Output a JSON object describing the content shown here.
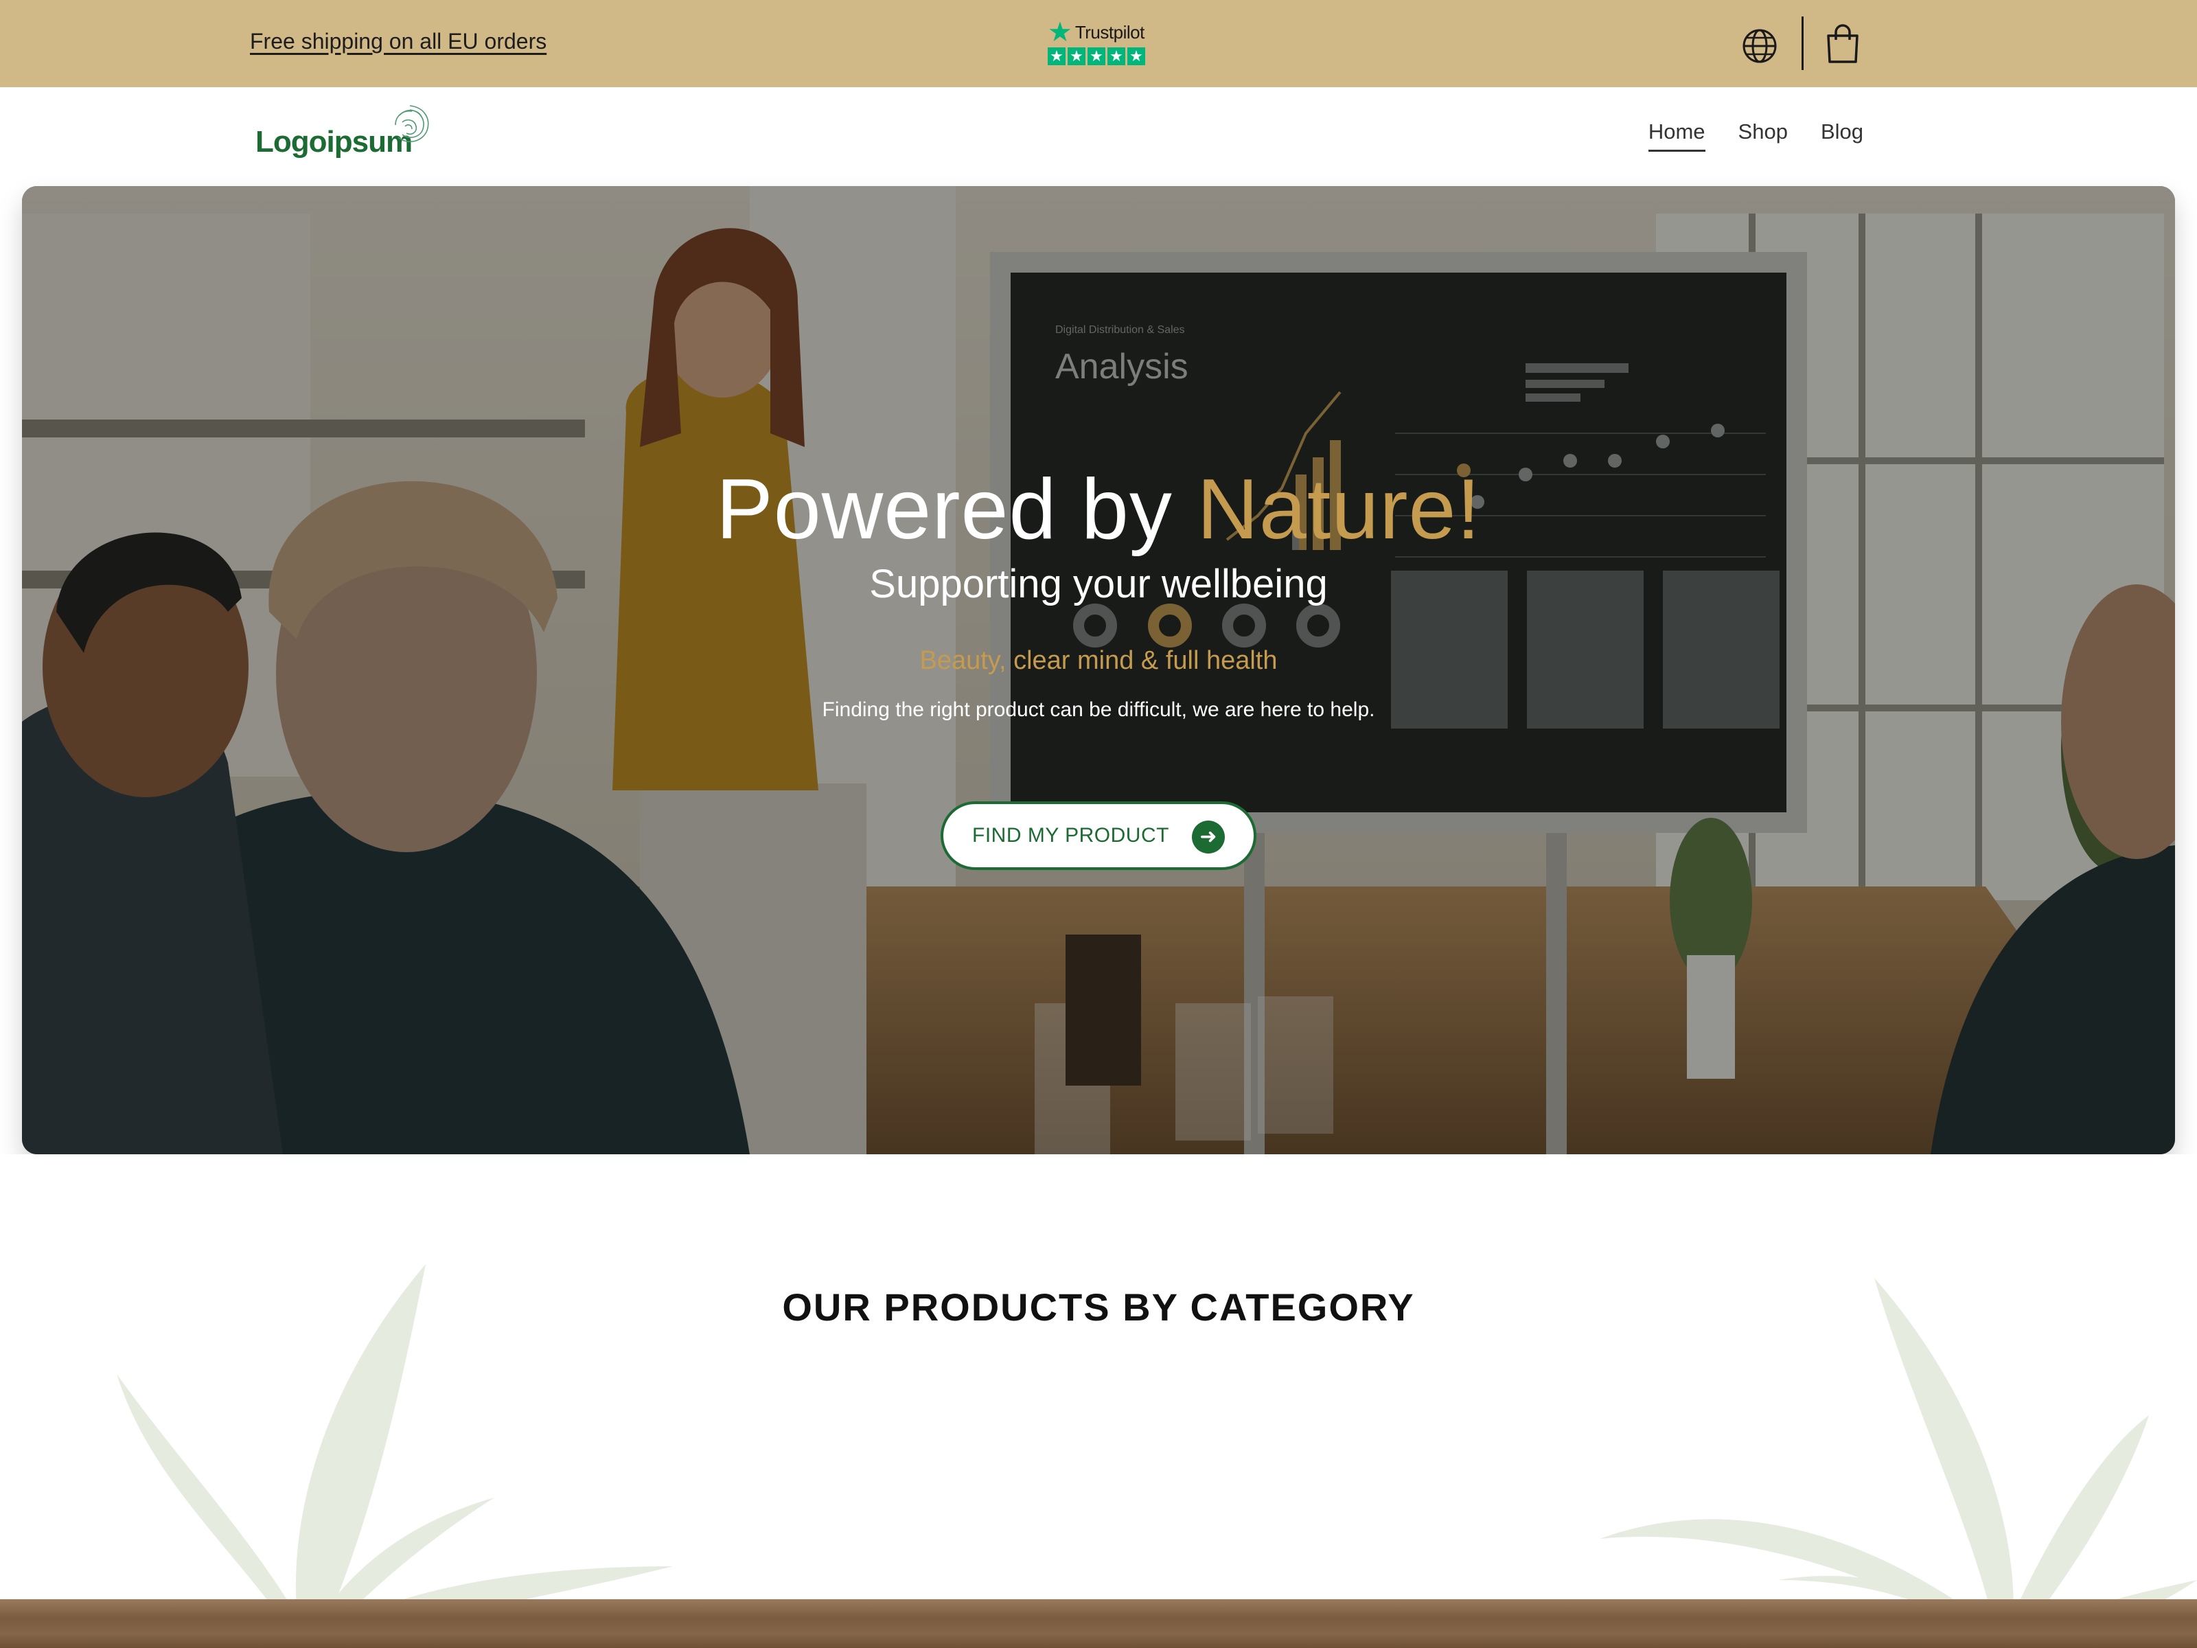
{
  "announcement": {
    "shipping_text": "Free shipping on all EU orders",
    "trustpilot_label": "Trustpilot",
    "trustpilot_stars": 5,
    "icons": [
      "globe-icon",
      "shopping-bag-icon"
    ]
  },
  "header": {
    "logo_text": "Logoipsum",
    "nav": [
      {
        "label": "Home",
        "active": true
      },
      {
        "label": "Shop",
        "active": false
      },
      {
        "label": "Blog",
        "active": false
      }
    ]
  },
  "hero": {
    "title_prefix": "Powered by ",
    "title_accent": "Nature!",
    "subtitle": "Supporting your wellbeing",
    "tagline": "Beauty, clear mind & full health",
    "description": "Finding the right product can be difficult, we are here to help.",
    "cta_label": "FIND MY PRODUCT",
    "screen_heading": "Digital Distribution & Sales",
    "screen_title": "Analysis"
  },
  "products": {
    "title": "OUR PRODUCTS BY CATEGORY"
  },
  "colors": {
    "announcement_bg": "#d1b887",
    "brand_green": "#1b6b33",
    "accent_gold": "#c59b50",
    "trustpilot_green": "#00b67a"
  }
}
